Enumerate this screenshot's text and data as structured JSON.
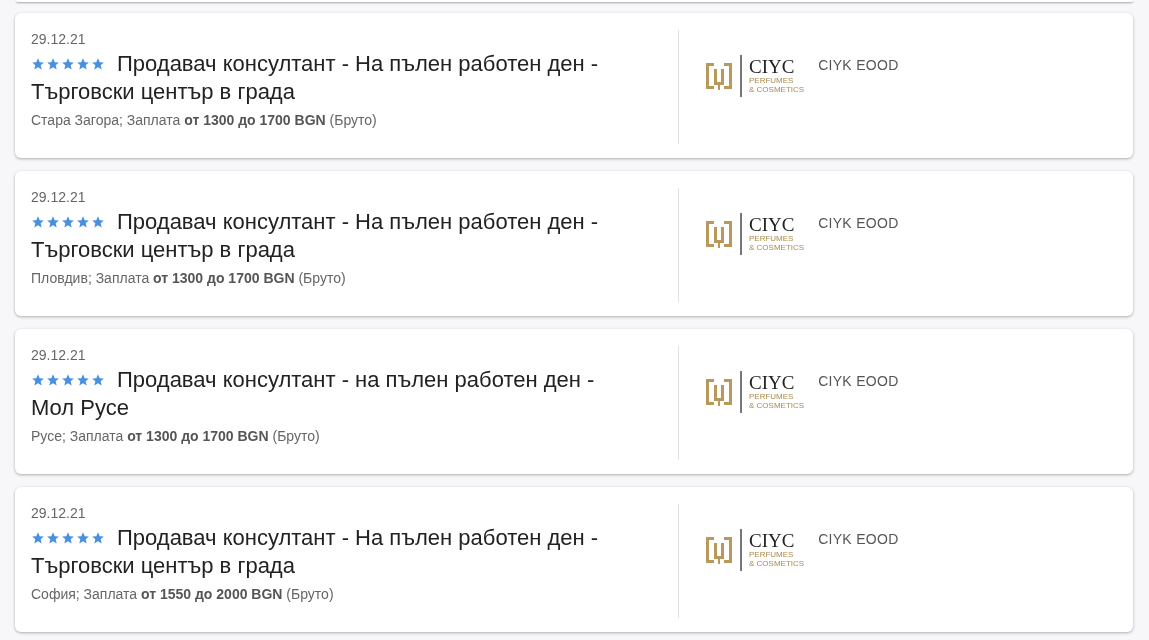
{
  "jobs": [
    {
      "date": "29.12.21",
      "stars": 5,
      "title": "Продавач консултант - На пълен работен ден - Търговски център в града",
      "details": "Стара Загора; Заплата **от 1300 до 1700 BGN** (Бруто)",
      "logo": {
        "name": "CIYC",
        "tagline": [
          "PERFUMES",
          "& COSMETICS"
        ]
      },
      "company": "CIYK EOOD"
    },
    {
      "date": "29.12.21",
      "stars": 5,
      "title": "Продавач консултант - На пълен работен ден - Търговски център в града",
      "details": "Пловдив; Заплата **от 1300 до 1700 BGN** (Бруто)",
      "logo": {
        "name": "CIYC",
        "tagline": [
          "PERFUMES",
          "& COSMETICS"
        ]
      },
      "company": "CIYK EOOD"
    },
    {
      "date": "29.12.21",
      "stars": 5,
      "title": "Продавач консултант - на пълен работен ден - Мол Русе",
      "details": "Русе; Заплата **от 1300 до 1700 BGN** (Бруто)",
      "logo": {
        "name": "CIYC",
        "tagline": [
          "PERFUMES",
          "& COSMETICS"
        ]
      },
      "company": "CIYK EOOD"
    },
    {
      "date": "29.12.21",
      "stars": 5,
      "title": "Продавач консултант - На пълен работен ден - Търговски център в града",
      "details": "София; Заплата **от 1550 до 2000 BGN** (Бруто)",
      "logo": {
        "name": "CIYC",
        "tagline": [
          "PERFUMES",
          "& COSMETICS"
        ]
      },
      "company": "CIYK EOOD"
    }
  ]
}
